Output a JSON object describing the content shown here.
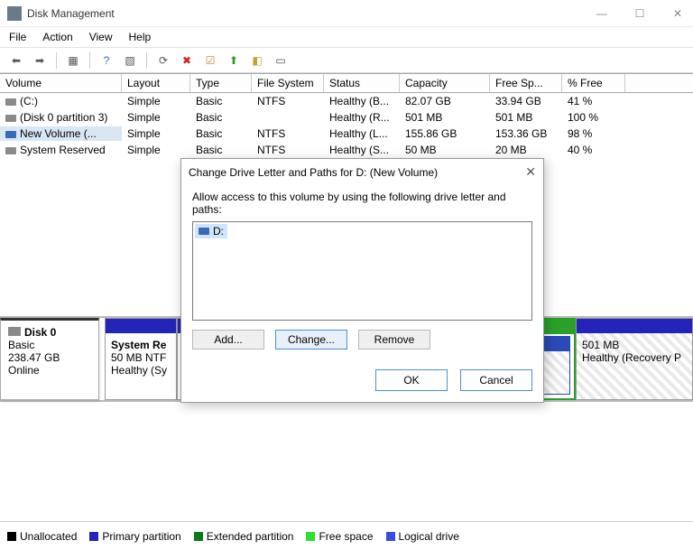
{
  "window": {
    "title": "Disk Management"
  },
  "menu": {
    "file": "File",
    "action": "Action",
    "view": "View",
    "help": "Help"
  },
  "columns": {
    "volume": "Volume",
    "layout": "Layout",
    "type": "Type",
    "fs": "File System",
    "status": "Status",
    "cap": "Capacity",
    "free": "Free Sp...",
    "pct": "% Free"
  },
  "rows": [
    {
      "vol": "(C:)",
      "lay": "Simple",
      "typ": "Basic",
      "fs": "NTFS",
      "stat": "Healthy (B...",
      "cap": "82.07 GB",
      "free": "33.94 GB",
      "pct": "41 %"
    },
    {
      "vol": "(Disk 0 partition 3)",
      "lay": "Simple",
      "typ": "Basic",
      "fs": "",
      "stat": "Healthy (R...",
      "cap": "501 MB",
      "free": "501 MB",
      "pct": "100 %"
    },
    {
      "vol": "New Volume (...",
      "lay": "Simple",
      "typ": "Basic",
      "fs": "NTFS",
      "stat": "Healthy (L...",
      "cap": "155.86 GB",
      "free": "153.36 GB",
      "pct": "98 %"
    },
    {
      "vol": "System Reserved",
      "lay": "Simple",
      "typ": "Basic",
      "fs": "NTFS",
      "stat": "Healthy (S...",
      "cap": "50 MB",
      "free": "20 MB",
      "pct": "40 %"
    }
  ],
  "disk": {
    "name": "Disk 0",
    "type": "Basic",
    "size": "238.47 GB",
    "state": "Online"
  },
  "parts": {
    "sys": {
      "name": "System Re",
      "l2": "50 MB NTF",
      "l3": "Healthy (Sy"
    },
    "rec": {
      "l1": "501 MB",
      "l2": "Healthy (Recovery P"
    }
  },
  "legend": {
    "unalloc": "Unallocated",
    "primary": "Primary partition",
    "ext": "Extended partition",
    "free": "Free space",
    "logical": "Logical drive"
  },
  "dialog": {
    "title": "Change Drive Letter and Paths for D: (New Volume)",
    "msg": "Allow access to this volume by using the following drive letter and paths:",
    "item": "D:",
    "add": "Add...",
    "change": "Change...",
    "remove": "Remove",
    "ok": "OK",
    "cancel": "Cancel"
  }
}
